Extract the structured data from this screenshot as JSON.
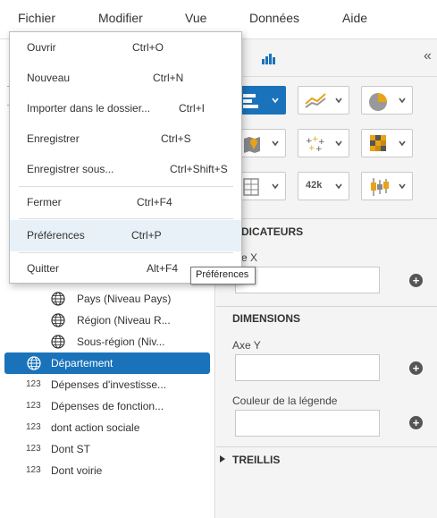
{
  "menubar": {
    "items": [
      "Fichier",
      "Modifier",
      "Vue",
      "Données",
      "Aide"
    ]
  },
  "file_menu": {
    "items": [
      {
        "label": "Ouvrir",
        "shortcut": "Ctrl+O"
      },
      {
        "label": "Nouveau",
        "shortcut": "Ctrl+N"
      },
      {
        "label": "Importer dans le dossier...",
        "shortcut": "Ctrl+I"
      },
      {
        "label": "Enregistrer",
        "shortcut": "Ctrl+S"
      },
      {
        "label": "Enregistrer sous...",
        "shortcut": "Ctrl+Shift+S"
      },
      {
        "label": "Fermer",
        "shortcut": "Ctrl+F4"
      },
      {
        "label": "Préférences",
        "shortcut": "Ctrl+P"
      },
      {
        "label": "Quitter",
        "shortcut": "Alt+F4"
      }
    ]
  },
  "tooltip": "Préférences",
  "fields": [
    {
      "type": "geo",
      "label": "Pays (Niveau Pays)"
    },
    {
      "type": "geo",
      "label": "Région (Niveau R..."
    },
    {
      "type": "geo",
      "label": "Sous-région (Niv..."
    },
    {
      "type": "geo",
      "label": "Département",
      "selected": true
    },
    {
      "type": "123",
      "label": "Dépenses d'investisse..."
    },
    {
      "type": "123",
      "label": "Dépenses de fonction..."
    },
    {
      "type": "123",
      "label": "dont action sociale"
    },
    {
      "type": "123",
      "label": "Dont ST"
    },
    {
      "type": "123",
      "label": "Dont voirie"
    }
  ],
  "right_panel": {
    "collapse_glyph": "«",
    "sections": {
      "indicateurs": "DICATEURS",
      "axe_x": "e X",
      "dimensions": "DIMENSIONS",
      "axe_y": "Axe Y",
      "couleur": "Couleur de la légende",
      "treillis": "TREILLIS"
    },
    "chart_buttons_text": {
      "value_42k": "42k"
    }
  },
  "colors": {
    "accent": "#1a73ba",
    "selected_row": "#1a73ba",
    "hover_row": "#e8f1f8"
  }
}
